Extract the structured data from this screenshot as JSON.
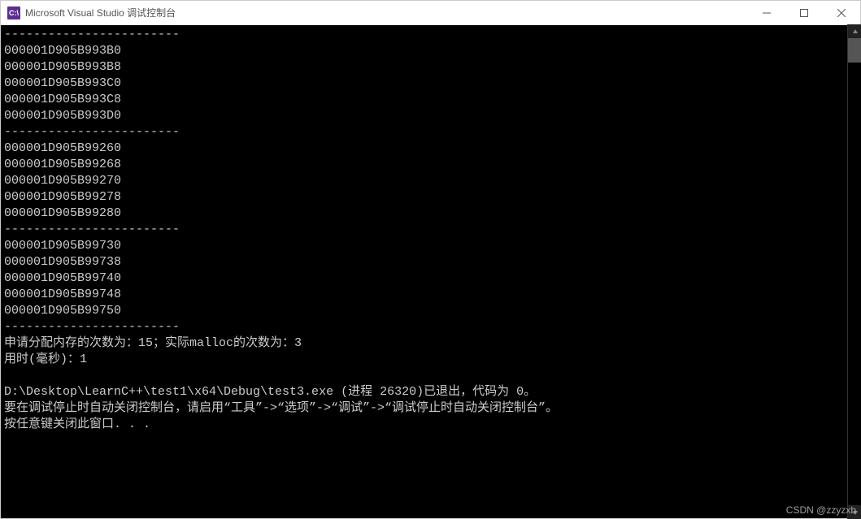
{
  "titlebar": {
    "icon_label": "C:\\",
    "title": "Microsoft Visual Studio 调试控制台"
  },
  "console": {
    "separator": "------------------------",
    "block1": [
      "000001D905B993B0",
      "000001D905B993B8",
      "000001D905B993C0",
      "000001D905B993C8",
      "000001D905B993D0"
    ],
    "block2": [
      "000001D905B99260",
      "000001D905B99268",
      "000001D905B99270",
      "000001D905B99278",
      "000001D905B99280"
    ],
    "block3": [
      "000001D905B99730",
      "000001D905B99738",
      "000001D905B99740",
      "000001D905B99748",
      "000001D905B99750"
    ],
    "summary_line": "申请分配内存的次数为：15；实际malloc的次数为：3",
    "time_line": "用时(毫秒)：1",
    "exit_line": "D:\\Desktop\\LearnC++\\test1\\x64\\Debug\\test3.exe (进程 26320)已退出，代码为 0。",
    "hint_line": "要在调试停止时自动关闭控制台，请启用“工具”->“选项”->“调试”->“调试停止时自动关闭控制台”。",
    "close_line": "按任意键关闭此窗口. . ."
  },
  "watermark": "CSDN @zzyzxb"
}
